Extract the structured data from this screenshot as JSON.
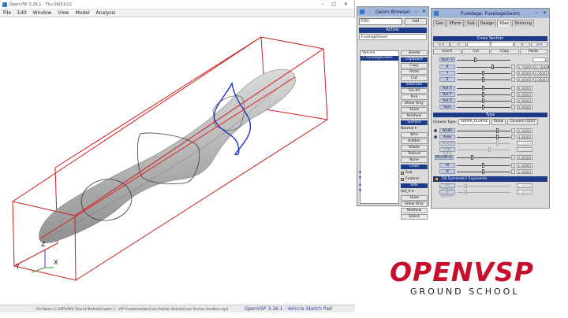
{
  "main_window": {
    "title": "OpenVSP 3.26.1 - Thu 09/01/22",
    "menu": [
      "File",
      "Edit",
      "Window",
      "View",
      "Model",
      "Analysis"
    ],
    "status_file": "File Name: C:\\VSP\\VSPU Tutorial Models\\Chapter 1 - VSP Fundamentals\\Cross-Section Details\\Cross-Section Sandbox.vsp3",
    "status_version": "OpenVSP 3.26.1 : Vehicle Sketch Pad",
    "axis_labels": {
      "x": "X",
      "y": "Y",
      "z": "Z"
    }
  },
  "geom_browser": {
    "title": "Geom Browser",
    "type_select": "POD",
    "add_label": "Add",
    "active_label": "Active:",
    "active_value": "FuselageGeom",
    "tree": [
      {
        "label": "Vehicle",
        "selected": false
      },
      {
        "label": "+ FuselageGeom",
        "selected": true
      }
    ],
    "delete_label": "Delete",
    "clipboard_header": "Clipboard",
    "clipboard": [
      "Copy",
      "Paste",
      "Cut"
    ],
    "selection_header": "Selection",
    "selection": [
      "Sel All",
      "Pick",
      "Show Only",
      "Show",
      "NoShow"
    ],
    "surface_header": "Surface",
    "surface_select": "Normal",
    "surface": [
      "Wire",
      "Hidden",
      "Shade",
      "Texture",
      "None"
    ],
    "lines_header": "Lines",
    "lines": [
      "Sub",
      "Feature"
    ],
    "sets_header": "Sets",
    "sets_select": "Set_0",
    "sets": [
      "Show",
      "Show Only",
      "NoShow",
      "Select"
    ]
  },
  "fuselage_window": {
    "title": "Fuselage: FuselageGeom",
    "tabs": [
      "Gen",
      "XForm",
      "Sub",
      "Design",
      "XSec",
      "Skinning"
    ],
    "active_tab": "XSec",
    "cross_section_header": "Cross Section",
    "nav": {
      "first": "<<",
      "prev": "<",
      "index": "3",
      "next": ">",
      "last": ">>"
    },
    "actions": [
      "Insert",
      "Cut",
      "Copy",
      "Paste"
    ],
    "num_u_label": "Num U",
    "num_u_value": "6",
    "params": [
      {
        "label": "X",
        "value": "0.75000",
        "value2": "22.50000"
      },
      {
        "label": "Y",
        "value": "0.00000",
        "value2": "0.00000"
      },
      {
        "label": "Z",
        "value": "0.00000",
        "value2": "0.00000"
      }
    ],
    "rot_params": [
      {
        "label": "Rot X",
        "value": "0.00000"
      },
      {
        "label": "Rot Y",
        "value": "0.00000"
      },
      {
        "label": "Rot Z",
        "value": "0.00000"
      },
      {
        "label": "Spin",
        "value": "0.00000"
      }
    ],
    "type_header": "Type",
    "choose_type_label": "Choose Type:",
    "choose_type_value": "SUPER_ELLIPSE",
    "show_label": "Show",
    "convert_label": "Convert CEDIT",
    "shape_params": [
      {
        "label": "Width",
        "value": "2.50000",
        "dim": false,
        "radio": true
      },
      {
        "label": "Area",
        "value": "4.00000",
        "dim": false,
        "radio": true
      },
      {
        "label": "Height",
        "value": "2.12100",
        "dim": true,
        "radio": false
      },
      {
        "label": "H/W Ratio",
        "value": "0.84840",
        "dim": true,
        "radio": false
      }
    ],
    "maxwloc": {
      "label": "MaxWLoc",
      "value": "0.00000"
    },
    "exponents": [
      {
        "label": "M",
        "value": "2.00000"
      },
      {
        "label": "N",
        "value": "2.00000"
      }
    ],
    "td_label": "T/B Symmetric Exponents",
    "bottom_exponents": [
      {
        "label": "M Bottom",
        "value": "2.00000"
      },
      {
        "label": "N Bottom",
        "value": "2.00000"
      }
    ]
  },
  "logo": {
    "main": "OPENVSP",
    "sub": "GROUND SCHOOL",
    "color": "#c8102e"
  }
}
